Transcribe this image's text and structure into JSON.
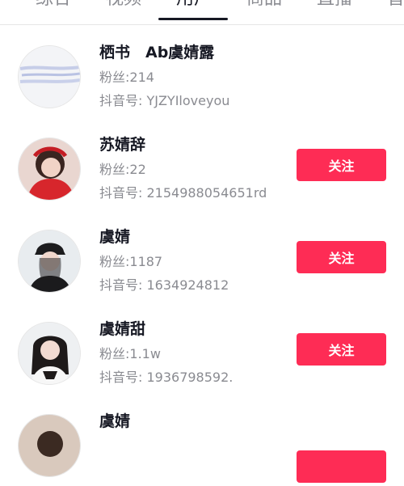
{
  "tabs": [
    {
      "label": "综合"
    },
    {
      "label": "视频"
    },
    {
      "label": "用户",
      "active": true
    },
    {
      "label": "商品"
    },
    {
      "label": "直播"
    },
    {
      "label": "音"
    }
  ],
  "users": [
    {
      "name": "栖书　Ab虞婧露",
      "fans": "粉丝:214",
      "douyin_id": "抖音号: YJZYIloveyou",
      "follow_label": ""
    },
    {
      "name": "苏婧辞",
      "fans": "粉丝:22",
      "douyin_id": "抖音号: 2154988054651rd",
      "follow_label": "关注"
    },
    {
      "name": "虞婧",
      "fans": "粉丝:1187",
      "douyin_id": "抖音号: 1634924812",
      "follow_label": "关注"
    },
    {
      "name": "虞婧甜",
      "fans": "粉丝:1.1w",
      "douyin_id": "抖音号: 1936798592.",
      "follow_label": "关注"
    },
    {
      "name": "虞婧",
      "fans": "",
      "douyin_id": "",
      "follow_label": ""
    }
  ],
  "colors": {
    "accent": "#fe2c55",
    "text_primary": "#161823",
    "text_secondary": "#8a8b91"
  }
}
